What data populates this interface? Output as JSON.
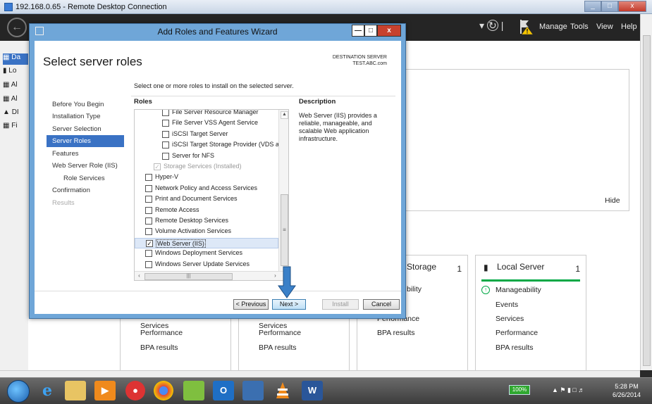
{
  "rdp": {
    "title": "192.168.0.65 - Remote Desktop Connection",
    "min": "_",
    "max": "□",
    "close": "x"
  },
  "server_manager": {
    "menu": [
      "Manage",
      "Tools",
      "View",
      "Help"
    ],
    "hide_label": "Hide",
    "nav": [
      "Da",
      "Lo",
      "Al",
      "Al",
      "DI",
      "Fi"
    ],
    "tiles": [
      {
        "title": "Storage",
        "count": "1",
        "rows": [
          "bility",
          "Performance",
          "BPA results"
        ]
      },
      {
        "title": "Local Server",
        "count": "1",
        "rows": [
          "Manageability",
          "Events",
          "Services",
          "Performance",
          "BPA results"
        ]
      }
    ],
    "back_panels": [
      {
        "rows": [
          "Services",
          "Performance",
          "BPA results"
        ]
      },
      {
        "rows": [
          "Services",
          "Performance",
          "BPA results"
        ]
      }
    ]
  },
  "wizard": {
    "title": "Add Roles and Features Wizard",
    "heading": "Select server roles",
    "destination_label": "DESTINATION SERVER",
    "destination_value": "TEST.ABC.com",
    "instruction": "Select one or more roles to install on the selected server.",
    "roles_header": "Roles",
    "description_header": "Description",
    "description": "Web Server (IIS) provides a reliable, manageable, and scalable Web application infrastructure.",
    "steps": [
      {
        "label": "Before You Begin",
        "state": "normal"
      },
      {
        "label": "Installation Type",
        "state": "normal"
      },
      {
        "label": "Server Selection",
        "state": "normal"
      },
      {
        "label": "Server Roles",
        "state": "selected"
      },
      {
        "label": "Features",
        "state": "normal"
      },
      {
        "label": "Web Server Role (IIS)",
        "state": "normal"
      },
      {
        "label": "Role Services",
        "state": "sub"
      },
      {
        "label": "Confirmation",
        "state": "normal"
      },
      {
        "label": "Results",
        "state": "disabled"
      }
    ],
    "roles": [
      {
        "label": "File Server Resource Manager",
        "checked": false,
        "indent": 2,
        "disabled": false
      },
      {
        "label": "File Server VSS Agent Service",
        "checked": false,
        "indent": 2,
        "disabled": false
      },
      {
        "label": "iSCSI Target Server",
        "checked": false,
        "indent": 2,
        "disabled": false
      },
      {
        "label": "iSCSI Target Storage Provider (VDS and VSS",
        "checked": false,
        "indent": 2,
        "disabled": false
      },
      {
        "label": "Server for NFS",
        "checked": false,
        "indent": 2,
        "disabled": false
      },
      {
        "label": "Storage Services (Installed)",
        "checked": true,
        "indent": 1,
        "disabled": true
      },
      {
        "label": "Hyper-V",
        "checked": false,
        "indent": 0,
        "disabled": false
      },
      {
        "label": "Network Policy and Access Services",
        "checked": false,
        "indent": 0,
        "disabled": false
      },
      {
        "label": "Print and Document Services",
        "checked": false,
        "indent": 0,
        "disabled": false
      },
      {
        "label": "Remote Access",
        "checked": false,
        "indent": 0,
        "disabled": false
      },
      {
        "label": "Remote Desktop Services",
        "checked": false,
        "indent": 0,
        "disabled": false
      },
      {
        "label": "Volume Activation Services",
        "checked": false,
        "indent": 0,
        "disabled": false
      },
      {
        "label": "Web Server (IIS)",
        "checked": true,
        "indent": 0,
        "disabled": false,
        "selected": true
      },
      {
        "label": "Windows Deployment Services",
        "checked": false,
        "indent": 0,
        "disabled": false
      },
      {
        "label": "Windows Server Update Services",
        "checked": false,
        "indent": 0,
        "disabled": false
      }
    ],
    "buttons": {
      "previous": "< Previous",
      "next": "Next >",
      "install": "Install",
      "cancel": "Cancel"
    }
  },
  "taskbar": {
    "battery": "100%",
    "time": "5:28 PM",
    "date": "6/26/2014",
    "apps": [
      "internet-explorer",
      "file-explorer",
      "media-player",
      "chrome-like",
      "chrome",
      "photos",
      "outlook",
      "remote-desktop",
      "vlc",
      "word"
    ]
  },
  "colors": {
    "accent": "#3a72c4",
    "wizard_frame": "#6fa6d8",
    "status_green": "#00a845",
    "annotation_arrow": "#3a80c8"
  }
}
